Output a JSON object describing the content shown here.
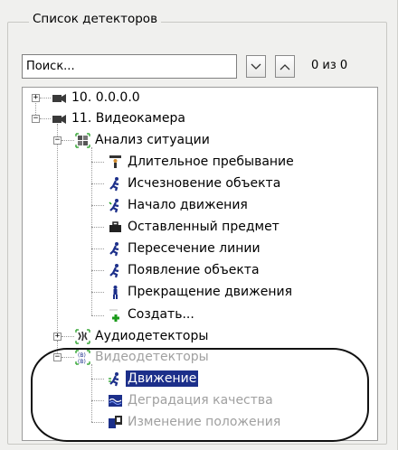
{
  "group_title": "Список детекторов",
  "search": {
    "placeholder": "Поиск...",
    "value": ""
  },
  "nav": {
    "down_symbol": "∨",
    "up_symbol": "∧"
  },
  "match_count": "0 из 0",
  "tree": {
    "node_ip": "10. 0.0.0.0",
    "node_camera": "11. Видеокамера",
    "situation_group": "Анализ ситуации",
    "situation_items": [
      "Длительное пребывание",
      "Исчезновение объекта",
      "Начало движения",
      "Оставленный предмет",
      "Пересечение линии",
      "Появление объекта",
      "Прекращение движения",
      "Создать..."
    ],
    "audio_group": "Аудиодетекторы",
    "video_group": "Видеодетекторы",
    "video_items": [
      "Движение",
      "Деградация качества",
      "Изменение положения"
    ]
  },
  "colors": {
    "selection": "#1c2f8a",
    "muted_text": "#a0a0a0",
    "tree_line": "#9a9a9a"
  }
}
